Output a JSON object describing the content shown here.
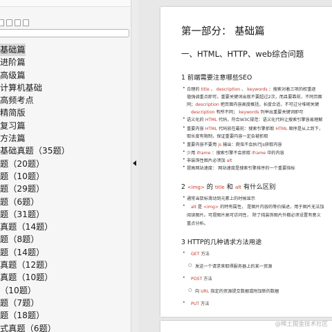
{
  "sidebar": {
    "search_placeholder": "",
    "toolbar_icons": [
      "outline-icon",
      "file-icon",
      "check-icon"
    ],
    "items": [
      {
        "label": "基础篇",
        "selected": true
      },
      {
        "label": "进阶篇"
      },
      {
        "label": "高级篇"
      },
      {
        "label": "计算机基础"
      },
      {
        "label": "高频考点"
      },
      {
        "label": "精简版"
      },
      {
        "label": "复习篇"
      },
      {
        "label": "方法篇"
      },
      {
        "label": "基础真题（35题）"
      },
      {
        "label": "题（20题）"
      },
      {
        "label": "题（10题）"
      },
      {
        "label": "题（29题）"
      },
      {
        "label": "题（6题）"
      },
      {
        "label": "题（31题）"
      },
      {
        "label": "真题（14题）"
      },
      {
        "label": "题（8题）"
      },
      {
        "label": "题（14题）"
      },
      {
        "label": "真题（12题）"
      },
      {
        "label": "真题（10题）"
      },
      {
        "label": "（10题）"
      },
      {
        "label": "题（7题）"
      },
      {
        "label": "题（18题）"
      },
      {
        "label": "式真题（6题）"
      }
    ]
  },
  "document": {
    "part_title": "第一部分：  基础篇",
    "section_title": "一、HTML、HTTP、web综合问题",
    "q1": {
      "heading": "1 前端需要注意哪些SEO",
      "b1": [
        "合理的 ",
        "title",
        " 、 ",
        "description",
        " 、 ",
        "keywords",
        " ：搜索对着三项的权重逐"
      ],
      "b1_l2": "值强调重点即可，重要关键词出现不要超过2次，而且要靠前，不同页面",
      "b1_l3_a": "同；",
      "b1_l3_code": "description",
      "b1_l3_b": " 把页面内容高度概括，长度合适，不可过分堆砌关键",
      "b1_l4_code1": "description",
      "b1_l4_a": " 有所不同；  ",
      "b1_l4_code2": "keywords",
      "b1_l4_b": " 列举出重要关键词即可",
      "b2_a": "语义化的 ",
      "b2_code": "HTML",
      "b2_b": " 代码，符合W3C规范：语义化代码让搜索引擎容易理解",
      "b3_a": "重要内容 ",
      "b3_code1": "HTML",
      "b3_b": " 代码放在最前：搜索引擎抓取 ",
      "b3_code2": "HTML",
      "b3_c": " 顺序是从上到下，",
      "b3_l2": "取长度有限制，保证重要内容一定会被抓取",
      "b4_a": "重要内容不要用 ",
      "b4_code": "js",
      "b4_b": " 输出：爬虫不会执行js获取内容",
      "b5_a": "少用 ",
      "b5_code1": "iframe",
      "b5_b": " ：搜索引擎不会抓取 ",
      "b5_code2": "iframe",
      "b5_c": " 中的内容",
      "b6_a": "非装饰性图片必须加 ",
      "b6_code": "alt",
      "b7": "提高网站速度：  网站速度是搜索引擎排序的一个重要指标"
    },
    "q2": {
      "heading_a": "2  ",
      "heading_code1": "<img>",
      "heading_b": " 的 ",
      "heading_code2": "title",
      "heading_c": " 和 ",
      "heading_code3": "alt",
      "heading_d": " 有什么区别",
      "b1": "通常当鼠标滑动到元素上的时候显示",
      "b2_code1": "alt",
      "b2_a": " 是 ",
      "b2_code2": "<img>",
      "b2_b": " 的特有属性，  是图片内容的等价描述，用于图片无法加",
      "b2_l2": "阅读图片。可提图片高可访问性，  除了纯装饰图片外都必须设置有意义",
      "b2_l3": "重点分析。"
    },
    "q3": {
      "heading": "3 HTTP的几种请求方法用途",
      "get_code": "GET",
      "get_label": " 方法",
      "get_desc": "发送一个请求来取得服务器上的某一资源",
      "post_code": "POST",
      "post_label": " 方法",
      "post_desc_a": "向 ",
      "post_desc_code": "URL",
      "post_desc_b": " 指定的资源提交数据或附加新的数据",
      "put_code": "PUT",
      "put_label": " 方法"
    },
    "watermark": "@稀土掘金技术社区"
  },
  "colors": {
    "code": "#c0392b",
    "selected_bg": "#d9d9d9",
    "page_bg": "#ffffff",
    "sidebar_bg": "#f6f6f6"
  }
}
